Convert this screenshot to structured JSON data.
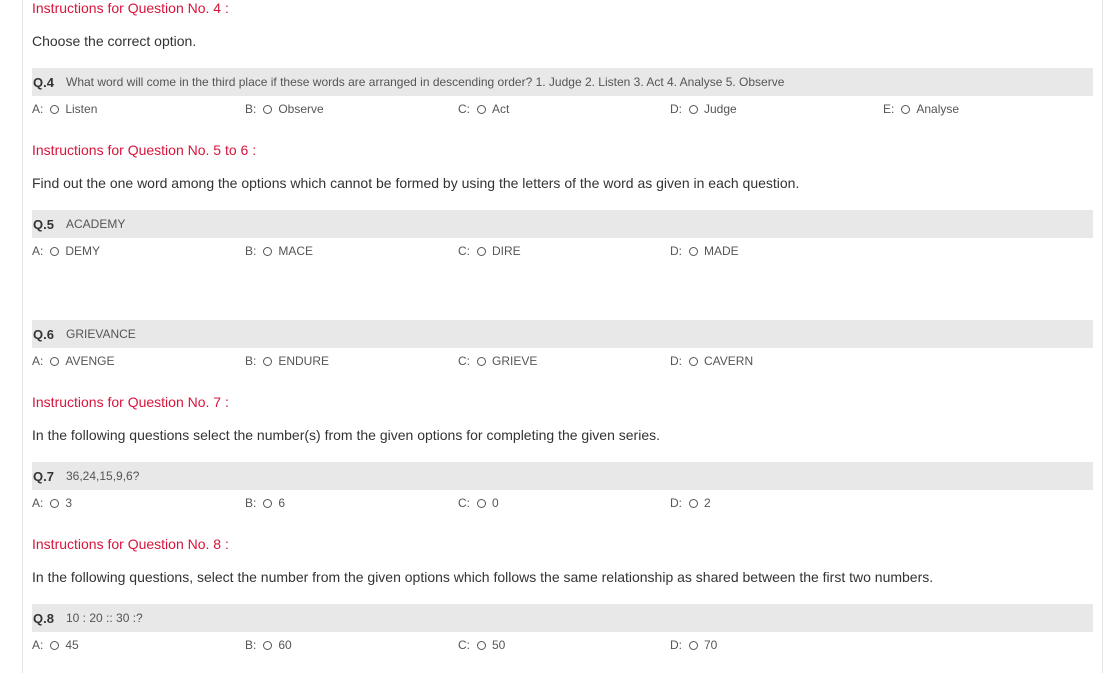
{
  "blocks": [
    {
      "instruction": "Instructions for Question No. 4 :",
      "description": "Choose the correct option.",
      "questions": [
        {
          "num": "Q.4",
          "text": "What word will come in the third place if these words are arranged in descending order? 1. Judge 2. Listen 3. Act 4. Analyse 5. Observe",
          "options": [
            {
              "letter": "A:",
              "text": "Listen"
            },
            {
              "letter": "B:",
              "text": "Observe"
            },
            {
              "letter": "C:",
              "text": "Act"
            },
            {
              "letter": "D:",
              "text": "Judge"
            },
            {
              "letter": "E:",
              "text": "Analyse"
            }
          ]
        }
      ]
    },
    {
      "instruction": "Instructions for Question No. 5 to 6 :",
      "description": "Find out the one word among the options which cannot be formed by using the letters of the word as given in each question.",
      "questions": [
        {
          "num": "Q.5",
          "text": "ACADEMY",
          "options": [
            {
              "letter": "A:",
              "text": "DEMY"
            },
            {
              "letter": "B:",
              "text": "MACE"
            },
            {
              "letter": "C:",
              "text": "DIRE"
            },
            {
              "letter": "D:",
              "text": "MADE"
            }
          ]
        },
        {
          "num": "Q.6",
          "text": "GRIEVANCE",
          "options": [
            {
              "letter": "A:",
              "text": "AVENGE"
            },
            {
              "letter": "B:",
              "text": "ENDURE"
            },
            {
              "letter": "C:",
              "text": "GRIEVE"
            },
            {
              "letter": "D:",
              "text": "CAVERN"
            }
          ]
        }
      ]
    },
    {
      "instruction": "Instructions for Question No. 7 :",
      "description": "In the following questions select the number(s) from the given options for completing the given series.",
      "questions": [
        {
          "num": "Q.7",
          "text": "36,24,15,9,6?",
          "options": [
            {
              "letter": "A:",
              "text": "3"
            },
            {
              "letter": "B:",
              "text": "6"
            },
            {
              "letter": "C:",
              "text": "0"
            },
            {
              "letter": "D:",
              "text": "2"
            }
          ]
        }
      ]
    },
    {
      "instruction": "Instructions for Question No. 8 :",
      "description": "In the following questions, select the number from the given options which follows the same relationship as shared between the first two numbers.",
      "questions": [
        {
          "num": "Q.8",
          "text": "10 : 20 :: 30 :?",
          "options": [
            {
              "letter": "A:",
              "text": "45"
            },
            {
              "letter": "B:",
              "text": "60"
            },
            {
              "letter": "C:",
              "text": "50"
            },
            {
              "letter": "D:",
              "text": "70"
            }
          ]
        }
      ]
    }
  ]
}
